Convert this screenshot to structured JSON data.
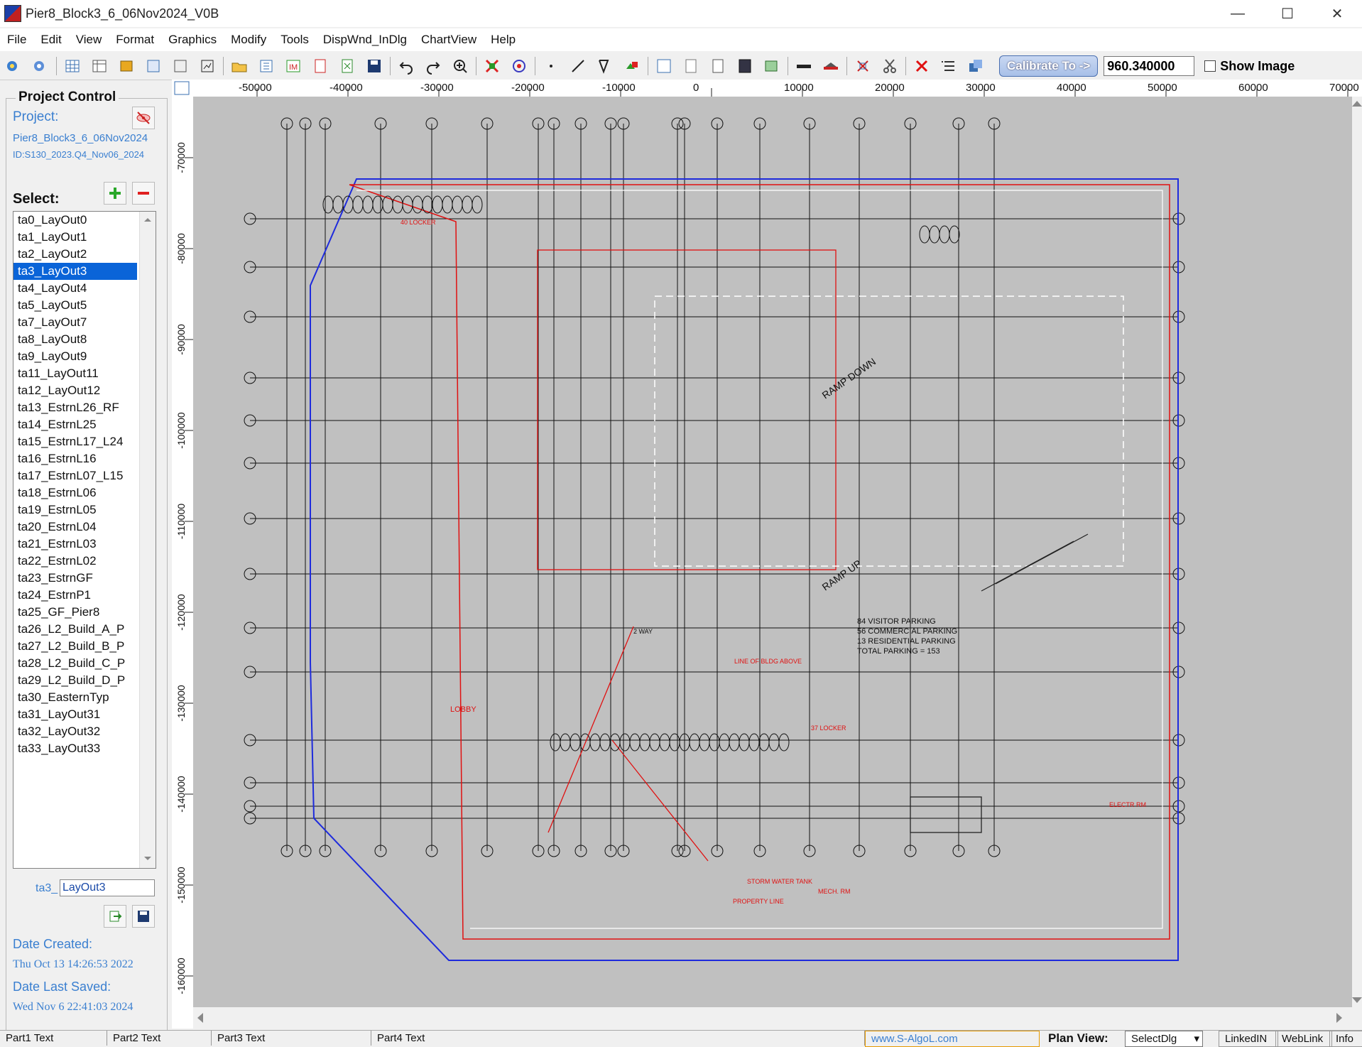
{
  "window": {
    "title": "Pier8_Block3_6_06Nov2024_V0B"
  },
  "menu": [
    "File",
    "Edit",
    "View",
    "Format",
    "Graphics",
    "Modify",
    "Tools",
    "DispWnd_InDlg",
    "ChartView",
    "Help"
  ],
  "toolbar": {
    "calibrate_label": "Calibrate To ->",
    "calibrate_value": "960.340000",
    "show_image_label": "Show Image"
  },
  "project_control": {
    "title": "Project Control",
    "project_label": "Project:",
    "project_name": "Pier8_Block3_6_06Nov2024",
    "project_id": "ID:S130_2023.Q4_Nov06_2024",
    "select_label": "Select:",
    "layouts": [
      "ta0_LayOut0",
      "ta1_LayOut1",
      "ta2_LayOut2",
      "ta3_LayOut3",
      "ta4_LayOut4",
      "ta5_LayOut5",
      "ta7_LayOut7",
      "ta8_LayOut8",
      "ta9_LayOut9",
      "ta11_LayOut11",
      "ta12_LayOut12",
      "ta13_EstrnL26_RF",
      "ta14_EstrnL25",
      "ta15_EstrnL17_L24",
      "ta16_EstrnL16",
      "ta17_EstrnL07_L15",
      "ta18_EstrnL06",
      "ta19_EstrnL05",
      "ta20_EstrnL04",
      "ta21_EstrnL03",
      "ta22_EstrnL02",
      "ta23_EstrnGF",
      "ta24_EstrnP1",
      "ta25_GF_Pier8",
      "ta26_L2_Build_A_P",
      "ta27_L2_Build_B_P",
      "ta28_L2_Build_C_P",
      "ta29_L2_Build_D_P",
      "ta30_EasternTyp",
      "ta31_LayOut31",
      "ta32_LayOut32",
      "ta33_LayOut33"
    ],
    "selected_index": 3,
    "prefix_label": "ta3_",
    "name_value": "LayOut3",
    "date_created_label": "Date Created:",
    "date_created": "Thu Oct 13 14:26:53 2022",
    "date_saved_label": "Date Last Saved:",
    "date_saved": "Wed Nov  6 22:41:03 2024"
  },
  "ruler": {
    "x_ticks": [
      "-50000",
      "-40000",
      "-30000",
      "-20000",
      "-10000",
      "0",
      "10000",
      "20000",
      "30000",
      "40000",
      "50000",
      "60000",
      "70000"
    ],
    "y_ticks": [
      "-70000",
      "-80000",
      "-90000",
      "-100000",
      "-110000",
      "-120000",
      "-130000",
      "-140000",
      "-150000",
      "-160000"
    ]
  },
  "drawing": {
    "labels": [
      "84 VISITOR PARKING",
      "56 COMMERCIAL PARKING",
      "13 RESIDENTIAL PARKING",
      "TOTAL PARKING = 153",
      "RAMP DOWN",
      "RAMP UP",
      "LOBBY",
      "PROPERTY LINE",
      "LINE OF BLDG ABOVE",
      "40 LOCKER",
      "37 LOCKER",
      "STORM WATER TANK",
      "MECH. RM",
      "2 WAY",
      "ELECTR RM"
    ]
  },
  "statusbar": {
    "part1": "Part1 Text",
    "part2": "Part2 Text",
    "part3": "Part3 Text",
    "part4": "Part4 Text",
    "weblink": "www.S-AlgoL.com",
    "plan_view_label": "Plan View:",
    "plan_view_value": "SelectDlg",
    "linkedin": "LinkedIN",
    "weblink2": "WebLink",
    "info": "Info"
  },
  "colors": {
    "selection": "#0a64d8",
    "blue_text": "#3a7fd0",
    "canvas_bg": "#c0c0c0",
    "property_line": "#1e2bdc",
    "red_annot": "#e01010"
  }
}
